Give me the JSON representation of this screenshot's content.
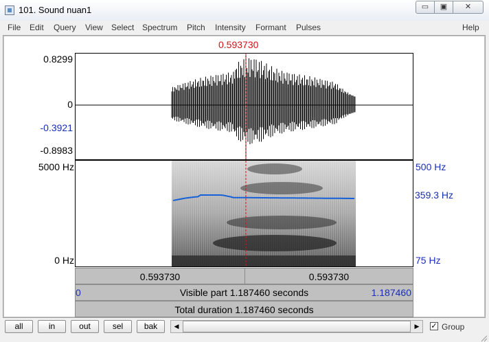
{
  "window": {
    "title": "101. Sound nuan1",
    "controls": {
      "minimize": "▭",
      "maximize": "▣",
      "close": "✕"
    }
  },
  "menu": {
    "items": [
      "File",
      "Edit",
      "Query",
      "View",
      "Select",
      "Spectrum",
      "Pitch",
      "Intensity",
      "Formant",
      "Pulses"
    ],
    "help": "Help"
  },
  "colors": {
    "cursor": "#d21010",
    "pitch": "#1560d8",
    "blue_text": "#1a2db5"
  },
  "waveform": {
    "max_label": "0.8299",
    "zero_label": "0",
    "cursor_value_label": "-0.3921",
    "min_label": "-0.8983"
  },
  "spectrogram": {
    "freq_max_label": "5000 Hz",
    "freq_min_label": "0 Hz",
    "pitch_max_label": "500 Hz",
    "pitch_cursor_label": "359.3 Hz",
    "pitch_min_label": "75 Hz"
  },
  "cursor": {
    "time_label": "0.593730",
    "time_seconds": 0.59373
  },
  "bars": {
    "left_segment": "0.593730",
    "right_segment": "0.593730",
    "visible_start": "0",
    "visible_part": "Visible part 1.187460 seconds",
    "visible_end": "1.187460",
    "total_duration": "Total duration 1.187460 seconds"
  },
  "toolbar": {
    "all": "all",
    "in": "in",
    "out": "out",
    "sel": "sel",
    "bak": "bak",
    "scroll_left": "◀",
    "scroll_right": "▶",
    "group_checked": "✓",
    "group_label": "Group"
  }
}
